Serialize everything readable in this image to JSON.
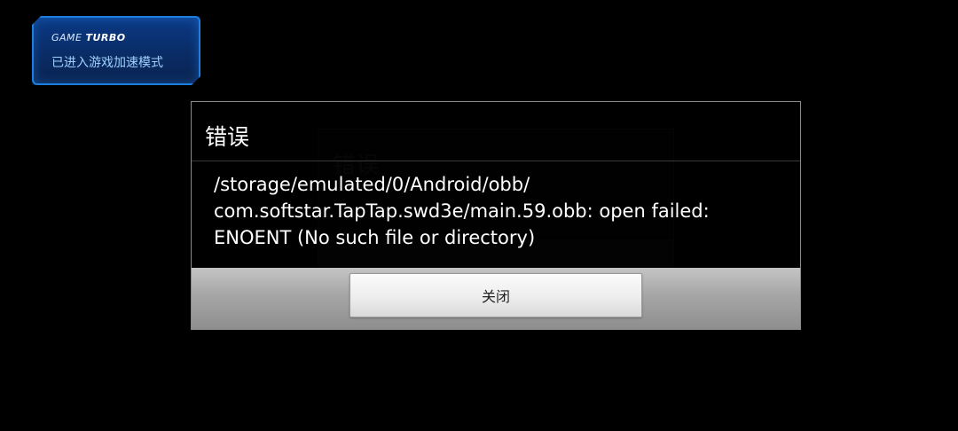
{
  "game_turbo": {
    "title_prefix": "GAME",
    "title_suffix": "TURBO",
    "subtitle": "已进入游戏加速模式"
  },
  "background_dialog": {
    "title": "错误"
  },
  "error_dialog": {
    "title": "错误",
    "message_lines": [
      "/storage/emulated/0/Android/obb/",
      "com.softstar.TapTap.swd3e/main.59.obb: open failed:",
      "ENOENT (No such file or directory)"
    ],
    "close_label": "关闭"
  },
  "colors": {
    "badge_border": "#1c7fe0",
    "badge_text": "#9fd0ff",
    "dialog_bg": "#000000",
    "footer_bar": "#a6a6a6"
  }
}
